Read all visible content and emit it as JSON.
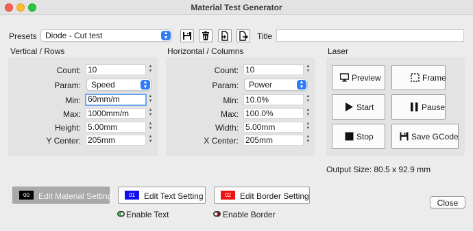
{
  "window": {
    "title": "Material Test Generator"
  },
  "toolbar": {
    "presets_label": "Presets",
    "preset_value": "Diode - Cut test",
    "title_label": "Title",
    "title_value": ""
  },
  "rows": {
    "heading": "Vertical / Rows",
    "fields": [
      {
        "label": "Count:",
        "value": "10"
      },
      {
        "label": "Param:",
        "value": "Speed"
      },
      {
        "label": "Min:",
        "value": "60mm/m"
      },
      {
        "label": "Max:",
        "value": "1000mm/m"
      },
      {
        "label": "Height:",
        "value": "5.00mm"
      },
      {
        "label": "Y Center:",
        "value": "205mm"
      }
    ]
  },
  "columns": {
    "heading": "Horizontal / Columns",
    "fields": [
      {
        "label": "Count:",
        "value": "10"
      },
      {
        "label": "Param:",
        "value": "Power"
      },
      {
        "label": "Min:",
        "value": "10.0%"
      },
      {
        "label": "Max:",
        "value": "100.0%"
      },
      {
        "label": "Width:",
        "value": "5.00mm"
      },
      {
        "label": "X Center:",
        "value": "205mm"
      }
    ]
  },
  "laser": {
    "heading": "Laser",
    "buttons": {
      "preview": "Preview",
      "frame": "Frame",
      "start": "Start",
      "pause": "Pause",
      "stop": "Stop",
      "save_gcode": "Save GCode"
    },
    "output_size": "Output Size: 80.5 x 92.9 mm"
  },
  "settings": {
    "material": {
      "badge": "00",
      "label": "Edit Material Setting",
      "color": "#000000"
    },
    "text": {
      "badge": "01",
      "label": "Edit Text Setting",
      "color": "#1010ee"
    },
    "border": {
      "badge": "02",
      "label": "Edit Border Setting",
      "color": "#ee1111"
    },
    "enable_text": {
      "label": "Enable Text",
      "state": "on",
      "color": "#34c038"
    },
    "enable_border": {
      "label": "Enable Border",
      "state": "off",
      "color": "#8b1a1a"
    }
  },
  "footer": {
    "close_label": "Close"
  },
  "icons": [
    "save-icon",
    "delete-icon",
    "import-icon",
    "export-icon",
    "monitor-icon",
    "frame-icon",
    "play-icon",
    "pause-icon",
    "stop-icon",
    "floppy-icon"
  ]
}
